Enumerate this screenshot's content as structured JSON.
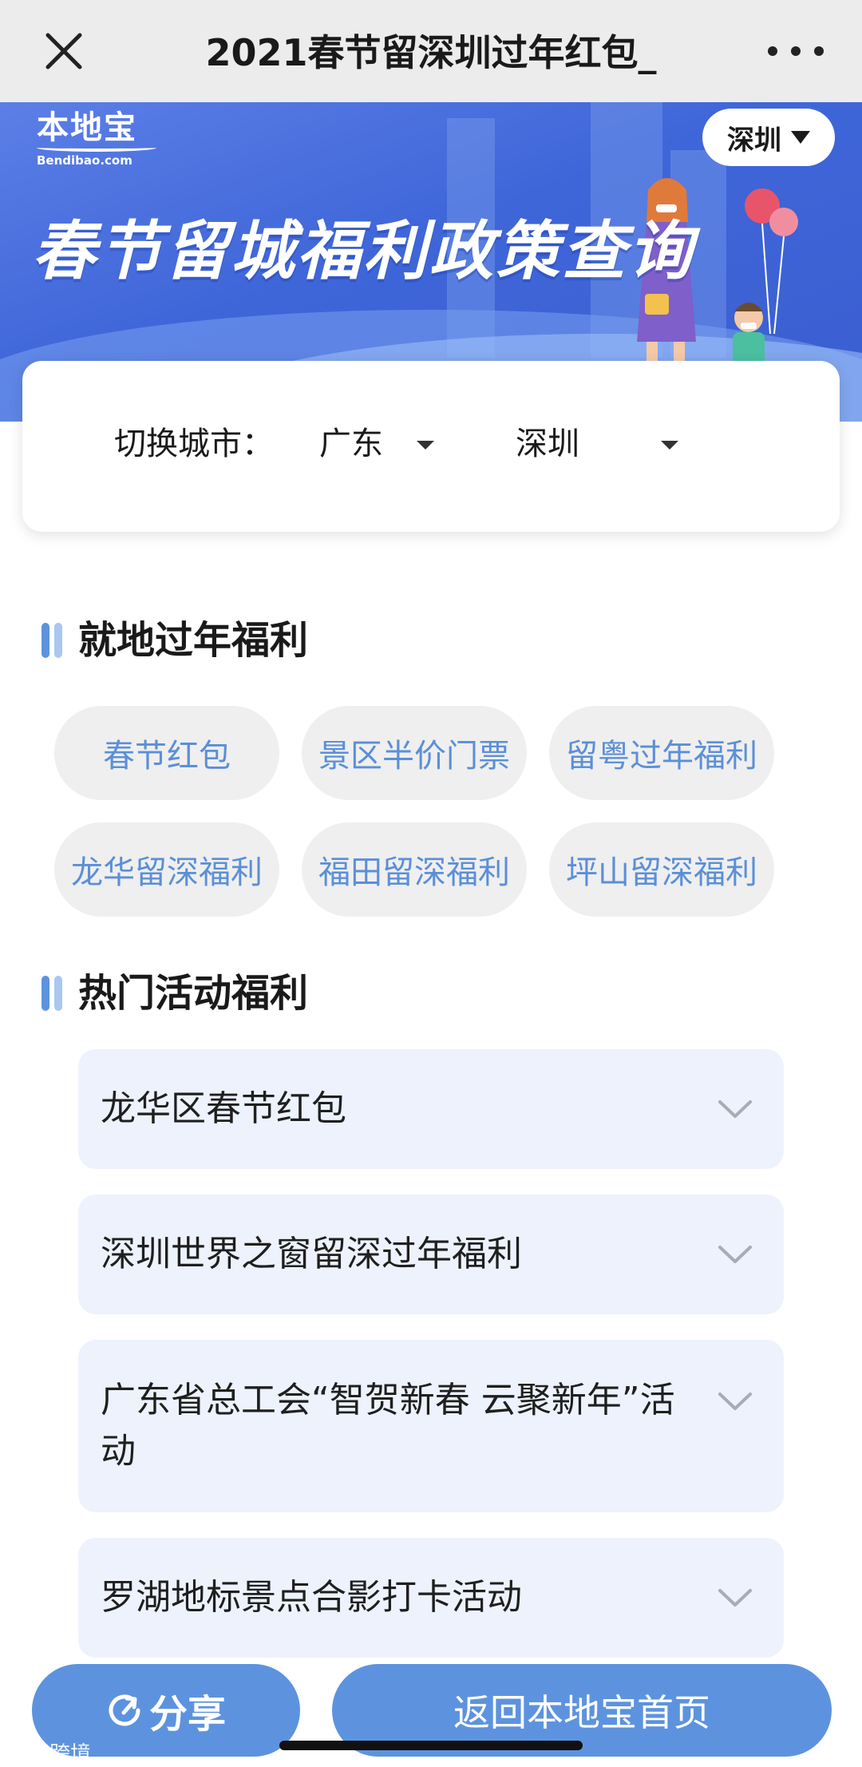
{
  "topbar": {
    "title": "2021春节留深圳过年红包_"
  },
  "banner": {
    "logo_cn": "本地宝",
    "logo_en": "Bendibao.com",
    "city": "深圳",
    "headline": "春节留城福利政策查询"
  },
  "city_switch": {
    "label": "切换城市：",
    "province": "广东",
    "city": "深圳"
  },
  "section_local": {
    "title": "就地过年福利",
    "chips": [
      "春节红包",
      "景区半价门票",
      "留粤过年福利",
      "龙华留深福利",
      "福田留深福利",
      "坪山留深福利"
    ]
  },
  "section_hot": {
    "title": "热门活动福利",
    "items": [
      "龙华区春节红包",
      "深圳世界之窗留深过年福利",
      "广东省总工会“智贺新春 云聚新年”活动",
      "罗湖地标景点合影打卡活动"
    ]
  },
  "bottom": {
    "share_label": "分享",
    "home_label": "返回本地宝首页"
  },
  "watermark": "大数跨境",
  "colors": {
    "accent": "#5d93de",
    "chip_text": "#5b8fd8",
    "banner": "#3f66d9",
    "card_bg": "#edf2fc"
  }
}
